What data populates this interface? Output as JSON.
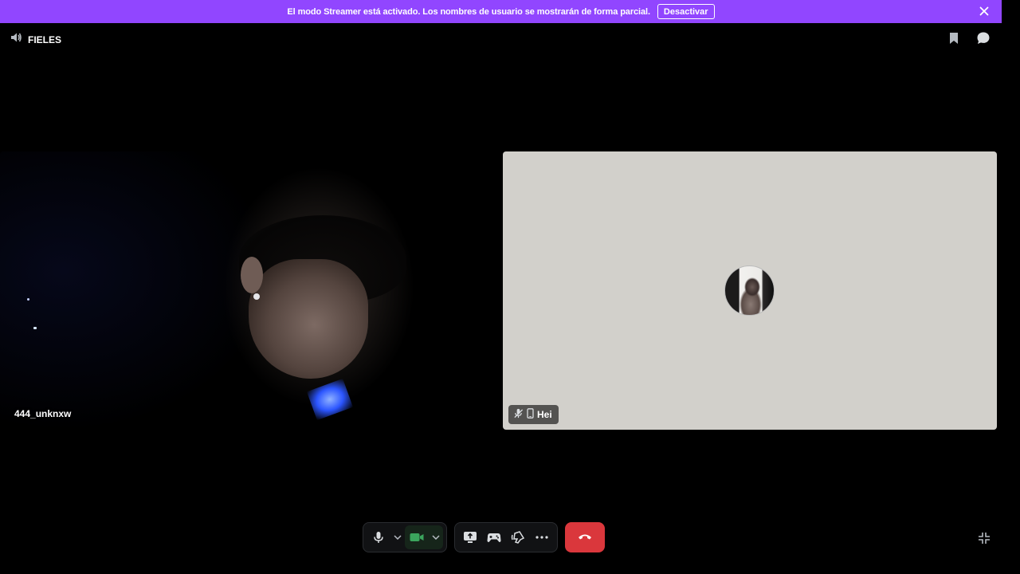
{
  "banner": {
    "message": "El modo Streamer está activado. Los nombres de usuario se mostrarán de forma parcial.",
    "deactivate_label": "Desactivar",
    "background_color": "#9146ff"
  },
  "header": {
    "channel_name": "FIELES",
    "icons": [
      "speaker-icon",
      "bookmark-icon",
      "chat-icon"
    ]
  },
  "participants": [
    {
      "name": "444_unknxw",
      "video": "webcam"
    },
    {
      "name": "Hei",
      "video": "avatar",
      "muted": true,
      "device": "mobile"
    }
  ],
  "controls": {
    "microphone": "mic-icon",
    "camera": "camera-icon",
    "camera_color": "#3ba55d",
    "hangup_color": "#da373c",
    "buttons": [
      "screen-share-icon",
      "activity-icon",
      "soundboard-icon",
      "more-icon"
    ]
  }
}
